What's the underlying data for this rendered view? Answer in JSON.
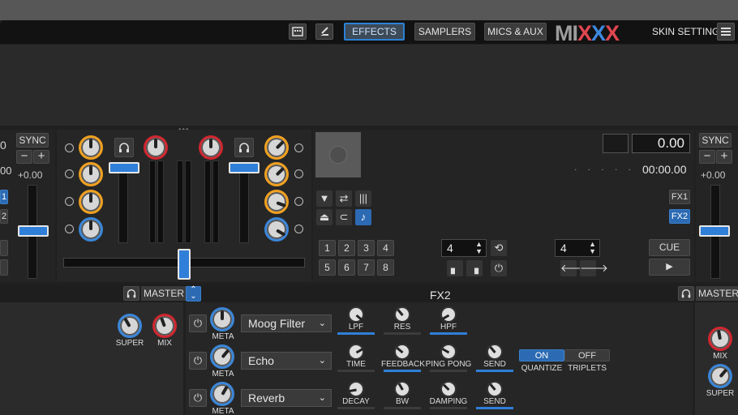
{
  "toolbar": {
    "effects": "EFFECTS",
    "samplers": "SAMPLERS",
    "mics_aux": "MICS & AUX",
    "logo_a": "MI",
    "logo_b": "X",
    "logo_c": "X",
    "logo_d": "X",
    "skin_settings": "SKIN SETTINGS"
  },
  "deck_left": {
    "time_partial": "0",
    "sync": "SYNC",
    "minus": "−",
    "plus": "+",
    "rate": "+0.00",
    "time_partial2": "00",
    "fx1": "1",
    "fx2": "2"
  },
  "deck_right": {
    "position": "0.00",
    "clock": "00:00.00",
    "dots": ". . . . .",
    "fx1": "FX1",
    "fx2": "FX2",
    "hotcues": [
      "1",
      "2",
      "3",
      "4",
      "5",
      "6",
      "7",
      "8"
    ],
    "loop_size": "4",
    "beatjump_size": "4",
    "cue": "CUE",
    "sync": "SYNC",
    "minus": "−",
    "plus": "+",
    "rate": "+0.00"
  },
  "fx_unit": {
    "title": "FX2",
    "master_left": "MASTER",
    "master_right": "MASTER",
    "left_super": "SUPER",
    "left_mix": "MIX",
    "right_mix": "MIX",
    "right_super": "SUPER",
    "effects": [
      {
        "meta": "META",
        "name": "Moog Filter",
        "params": [
          "LPF",
          "RES",
          "HPF"
        ]
      },
      {
        "meta": "META",
        "name": "Echo",
        "params": [
          "TIME",
          "FEEDBACK",
          "PING PONG",
          "SEND"
        ]
      },
      {
        "meta": "META",
        "name": "Reverb",
        "params": [
          "DECAY",
          "BW",
          "DAMPING",
          "SEND"
        ]
      }
    ],
    "quantize_on": "ON",
    "triplets_off": "OFF",
    "quantize": "QUANTIZE",
    "triplets": "TRIPLETS"
  },
  "colors": {
    "accent_blue": "#2f7fd8",
    "orange": "#f0a020",
    "red": "#d0262f"
  }
}
